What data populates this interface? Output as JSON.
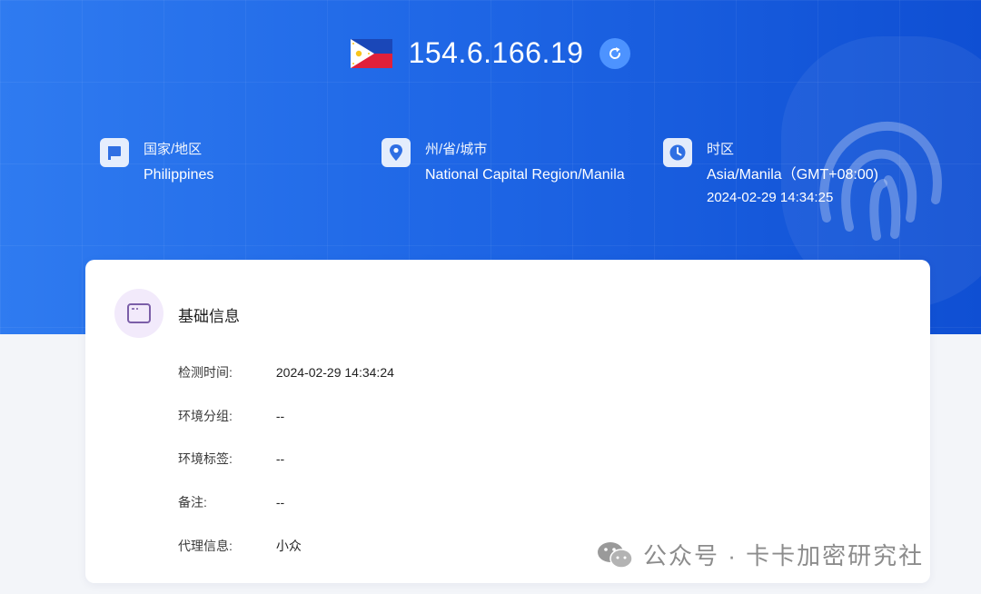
{
  "header": {
    "ip": "154.6.166.19",
    "flag_country": "Philippines"
  },
  "location": {
    "country": {
      "label": "国家/地区",
      "value": "Philippines"
    },
    "region": {
      "label": "州/省/城市",
      "value": "National Capital Region/Manila"
    },
    "timezone": {
      "label": "时区",
      "value": "Asia/Manila（GMT+08:00)",
      "time": "2024-02-29 14:34:25"
    }
  },
  "basic_info": {
    "title": "基础信息",
    "rows": [
      {
        "label": "检测时间:",
        "value": "2024-02-29 14:34:24"
      },
      {
        "label": "环境分组:",
        "value": "--"
      },
      {
        "label": "环境标签:",
        "value": "--"
      },
      {
        "label": "备注:",
        "value": "--"
      },
      {
        "label": "代理信息:",
        "value": "小众"
      }
    ]
  },
  "watermark": {
    "text": "公众号 · 卡卡加密研究社"
  },
  "colors": {
    "hero_start": "#2f7bf0",
    "hero_end": "#0f4fd3",
    "accent": "#4d93ff",
    "card_icon_bg": "#f2eafb",
    "card_icon_stroke": "#7b5ea8"
  },
  "icons": [
    "flag-ph-icon",
    "refresh-icon",
    "flag-icon",
    "location-pin-icon",
    "clock-icon",
    "browser-window-icon",
    "fingerprint-icon",
    "wechat-icon"
  ]
}
